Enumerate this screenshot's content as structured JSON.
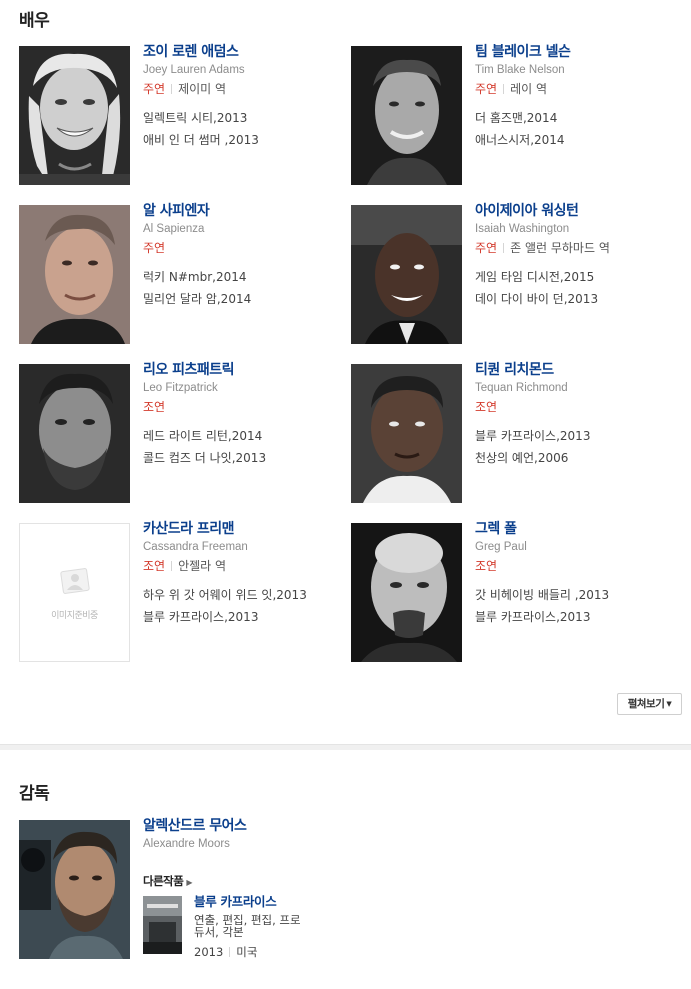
{
  "actors_section": {
    "title": "배우",
    "more_button": "펼쳐보기",
    "actors": [
      {
        "name_kr": "조이 로렌 애덤스",
        "name_en": "Joey Lauren Adams",
        "role": "주연",
        "character": "제이미 역",
        "works": [
          "일렉트릭 시티,2013",
          "애비 인 더 썸머 ,2013"
        ]
      },
      {
        "name_kr": "팀 블레이크 넬슨",
        "name_en": "Tim Blake Nelson",
        "role": "주연",
        "character": "레이 역",
        "works": [
          "더 홈즈맨,2014",
          "애너스시저,2014"
        ]
      },
      {
        "name_kr": "알 사피엔자",
        "name_en": "Al Sapienza",
        "role": "주연",
        "character": "",
        "works": [
          "럭키 N#mbr,2014",
          "밀리언 달라 암,2014"
        ]
      },
      {
        "name_kr": "아이제이아 워싱턴",
        "name_en": "Isaiah Washington",
        "role": "주연",
        "character": "존 앨런 무하마드 역",
        "works": [
          "게임 타임 디시전,2015",
          "데이 다이 바이 던,2013"
        ]
      },
      {
        "name_kr": "리오 피츠패트릭",
        "name_en": "Leo Fitzpatrick",
        "role": "조연",
        "character": "",
        "works": [
          "레드 라이트 리턴,2014",
          "콜드 컴즈 더 나잇,2013"
        ]
      },
      {
        "name_kr": "티퀀 리치몬드",
        "name_en": "Tequan Richmond",
        "role": "조연",
        "character": "",
        "works": [
          "블루 카프라이스,2013",
          "천상의 예언,2006"
        ]
      },
      {
        "name_kr": "카산드라 프리맨",
        "name_en": "Cassandra Freeman",
        "role": "조연",
        "character": "안젤라 역",
        "works": [
          "하우 위 갓 어웨이 위드 잇,2013",
          "블루 카프라이스,2013"
        ],
        "photo_placeholder": "이미지준비중"
      },
      {
        "name_kr": "그렉 폴",
        "name_en": "Greg Paul",
        "role": "조연",
        "character": "",
        "works": [
          "갓 비헤이빙 배들리 ,2013",
          "블루 카프라이스,2013"
        ]
      }
    ]
  },
  "director_section": {
    "title": "감독",
    "name_kr": "알렉산드르 무어스",
    "name_en": "Alexandre Moors",
    "other_works_label": "다른작품",
    "film": {
      "title": "블루 카프라이스",
      "roles": "연출, 편집, 편집, 프로듀서, 각본",
      "year": "2013",
      "country": "미국"
    }
  },
  "colors": {
    "link": "#0b3f8c",
    "role": "#d33a2c",
    "subtext": "#8c8c8c"
  }
}
